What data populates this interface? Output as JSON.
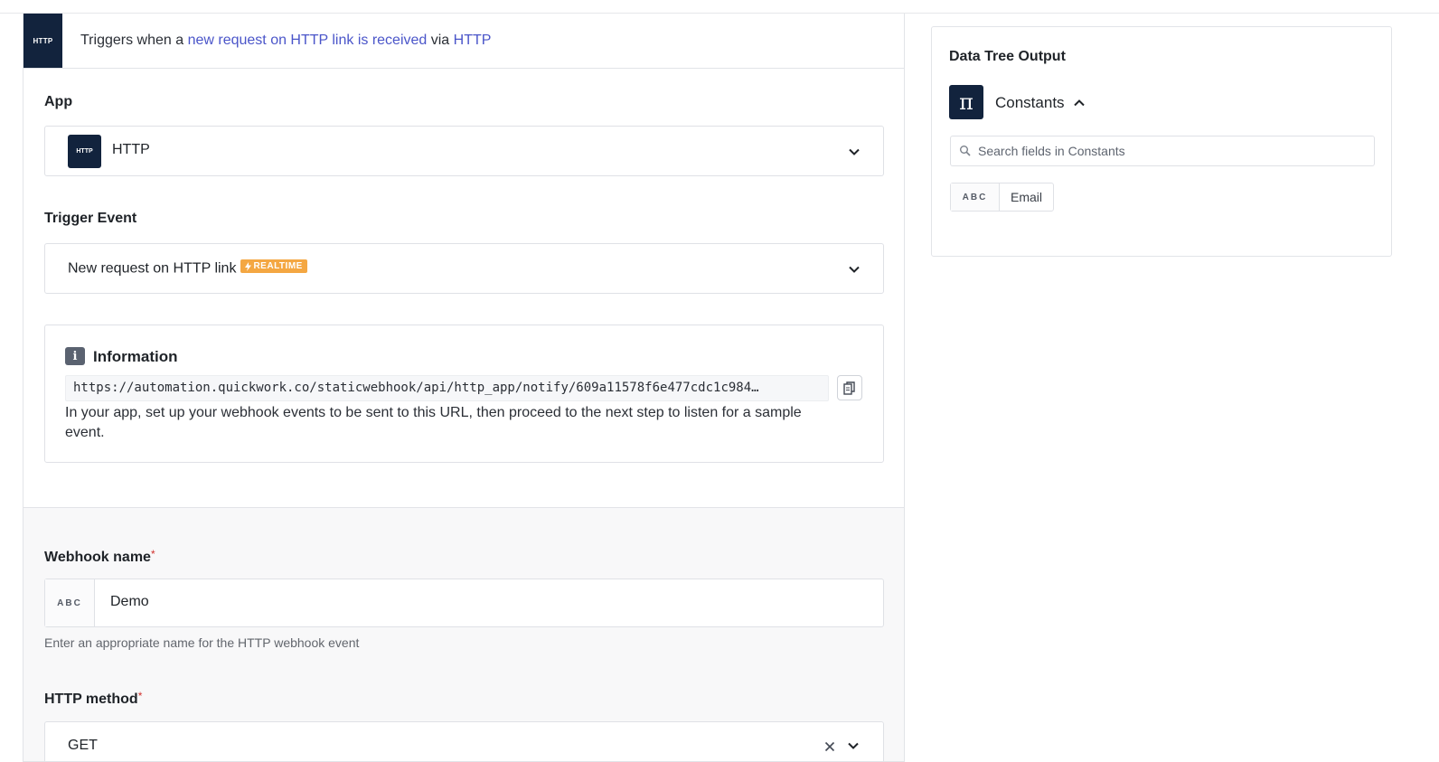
{
  "trigger": {
    "icon_label": "HTTP",
    "prefix": "Triggers when a ",
    "event_link": "new request on HTTP link is received",
    "mid": " via ",
    "app_link": "HTTP"
  },
  "app_field": {
    "label": "App",
    "icon_label": "HTTP",
    "value": "HTTP"
  },
  "trigger_event": {
    "label": "Trigger Event",
    "value": "New request on HTTP link",
    "badge": "REALTIME"
  },
  "information": {
    "title": "Information",
    "icon": "i",
    "url": "https://automation.quickwork.co/staticwebhook/api/http_app/notify/609a11578f6e477cdc1c984…",
    "description": "In your app, set up your webhook events to be sent to this URL, then proceed to the next step to listen for a sample event."
  },
  "webhook_name": {
    "label": "Webhook name",
    "required_mark": "*",
    "type_tag": "ABC",
    "value": "Demo",
    "help": "Enter an appropriate name for the HTTP webhook event"
  },
  "http_method": {
    "label": "HTTP method",
    "required_mark": "*",
    "value": "GET"
  },
  "data_tree": {
    "title": "Data Tree Output",
    "source_icon": "π",
    "source_label": "Constants",
    "search_placeholder": "Search fields in Constants",
    "fields": [
      {
        "type": "ABC",
        "name": "Email"
      }
    ]
  },
  "colors": {
    "brand_dark": "#12233d",
    "link": "#4a55c9",
    "realtime_badge": "#f4a742",
    "required": "#d0312d"
  }
}
